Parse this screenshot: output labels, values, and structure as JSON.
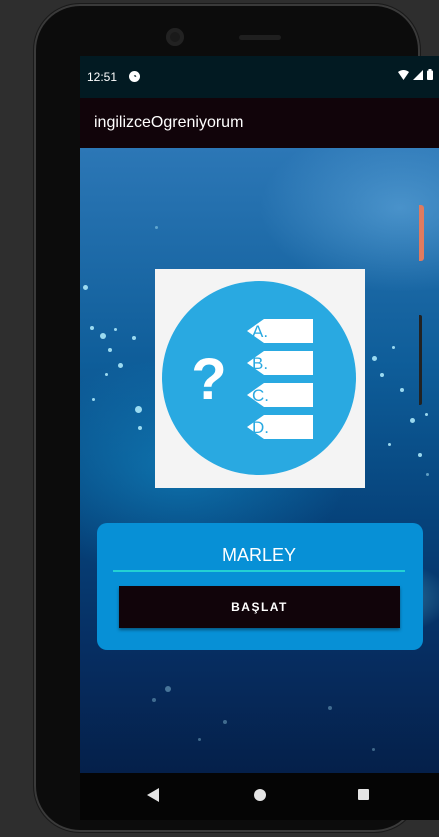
{
  "status_bar": {
    "time": "12:51",
    "notification_icon": "android-notification-icon",
    "icons": [
      "wifi-icon",
      "cellular-signal-icon",
      "battery-icon"
    ]
  },
  "app_bar": {
    "title": "ingilizceOgreniyorum"
  },
  "quiz_image": {
    "icon": "quiz-question-icon",
    "question_mark": "?",
    "options": [
      "A.",
      "B.",
      "C.",
      "D."
    ],
    "circle_color": "#29a9e1"
  },
  "form": {
    "name_value": "MARLEY",
    "start_label": "BAŞLAT"
  },
  "nav_bar": {
    "icons": [
      "back-icon",
      "home-icon",
      "recent-apps-icon"
    ]
  },
  "colors": {
    "card": "#0790d6",
    "button": "#11040a",
    "input_underline": "#23d1d4"
  }
}
